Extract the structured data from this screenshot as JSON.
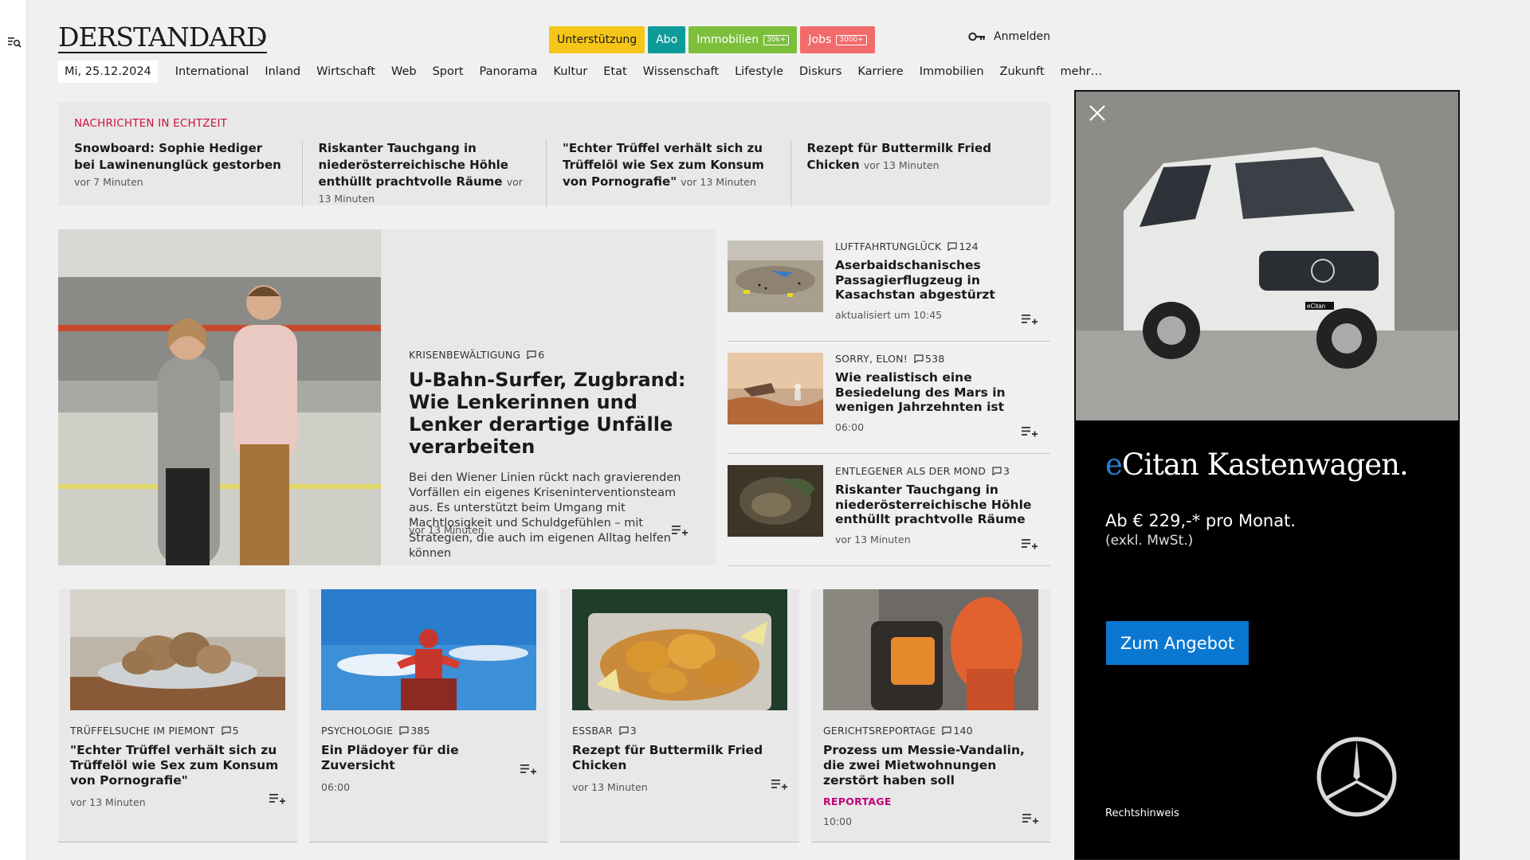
{
  "header": {
    "logo": "DERSTANDARD",
    "pills": {
      "support": "Unterstützung",
      "abo": "Abo",
      "immo": "Immobilien",
      "immo_badge": "30k+",
      "jobs": "Jobs",
      "jobs_badge": "3000+"
    },
    "login": "Anmelden"
  },
  "nav": {
    "date": "Mi, 25.12.2024",
    "items": [
      "International",
      "Inland",
      "Wirtschaft",
      "Web",
      "Sport",
      "Panorama",
      "Kultur",
      "Etat",
      "Wissenschaft",
      "Lifestyle",
      "Diskurs",
      "Karriere",
      "Immobilien",
      "Zukunft",
      "mehr…"
    ]
  },
  "ticker": {
    "heading": "NACHRICHTEN IN ECHTZEIT",
    "items": [
      {
        "title": "Snowboard: Sophie Hediger bei Lawi­nenunglück gestorben",
        "time": "vor 7 Minuten"
      },
      {
        "title": "Riskanter Tauchgang in niederöster­reichische Höhle enthüllt prachtvolle Räume",
        "time": "vor 13 Minuten"
      },
      {
        "title": "\"Echter Trüffel verhält sich zu Trüf­felöl wie Sex zum Konsum von Porno­grafie\"",
        "time": "vor 13 Minuten"
      },
      {
        "title": "Rezept für Buttermilk Fried Chicken",
        "time": "vor 13 Minuten"
      }
    ]
  },
  "lead": {
    "kicker": "KRISENBEWÄLTIGUNG",
    "comments": "6",
    "title": "U-Bahn-Surfer, Zugbrand: Wie Lenkerinnen und Lenker derartige Unfälle verarbeiten",
    "teaser": "Bei den Wiener Linien rückt nach gravierenden Vorfällen ein eigenes Kriseninterventionsteam aus. Es unterstützt beim Umgang mit Machtlosigkeit und Schuldgefühlen – mit Strategien, die auch im eigenen Alltag helfen können",
    "time": "vor 13 Minuten"
  },
  "side": [
    {
      "kicker": "LUFTFAHRTUNGLÜCK",
      "comments": "124",
      "title": "Aserbaidschanisches Passagier­flugzeug in Kasachstan abgestürzt",
      "time": "aktualisiert um 10:45"
    },
    {
      "kicker": "SORRY, ELON!",
      "comments": "538",
      "title": "Wie realistisch eine Besiedelung des Mars in wenigen Jahrzehnten ist",
      "time": "06:00"
    },
    {
      "kicker": "ENTLEGENER ALS DER MOND",
      "comments": "3",
      "title": "Riskanter Tauchgang in niederös­terreichische Höhle enthüllt prachtvolle Räume",
      "time": "vor 13 Minuten"
    }
  ],
  "cards": [
    {
      "kicker": "TRÜFFELSUCHE IM PIEMONT",
      "comments": "5",
      "title": "\"Echter Trüffel verhält sich zu Trüffelöl wie Sex zum Konsum von Pornografie\"",
      "time": "vor 13 Minuten",
      "label": ""
    },
    {
      "kicker": "PSYCHOLOGIE",
      "comments": "385",
      "title": "Ein Plädoyer für die Zuversicht",
      "time": "06:00",
      "label": ""
    },
    {
      "kicker": "ESSBAR",
      "comments": "3",
      "title": "Rezept für Buttermilk Fried Chicken",
      "time": "vor 13 Minuten",
      "label": ""
    },
    {
      "kicker": "GERICHTSREPORTAGE",
      "comments": "140",
      "title": "Prozess um Messie-Vandalin, die zwei Mietwohnungen zerstört haben soll",
      "time": "10:00",
      "label": "REPORTAGE"
    }
  ],
  "ad": {
    "title_e": "e",
    "title_rest": "Citan Kastenwagen.",
    "price": "Ab € 229,-* pro Monat.",
    "vat": "(exkl. MwSt.)",
    "cta": "Zum Angebot",
    "legal": "Rechtshinweis",
    "badge": "eCitan"
  },
  "colors": {
    "ticker_heading": "#d0113f",
    "support": "#f5c518",
    "abo": "#0e9a9a",
    "immo": "#7cbf3b",
    "jobs": "#f26b6b",
    "reportage": "#c2007a",
    "ad_button": "#0a78d1"
  }
}
